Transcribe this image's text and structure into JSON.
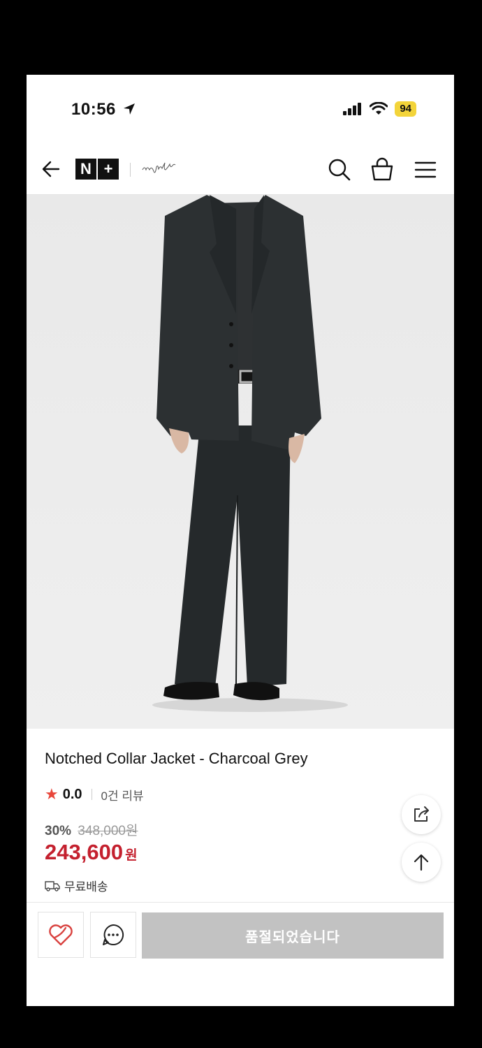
{
  "status_bar": {
    "time": "10:56",
    "battery": "94"
  },
  "header": {
    "logo_left": "N",
    "logo_right": "+",
    "brand_signature": "nyouth"
  },
  "product": {
    "title": "Notched Collar Jacket - Charcoal Grey",
    "rating": "0.0",
    "review_count": "0건 리뷰",
    "discount_percent": "30%",
    "original_price": "348,000원",
    "price": "243,600",
    "currency": "원",
    "shipping": "무료배송"
  },
  "actions": {
    "buy_label": "품절되었습니다"
  },
  "colors": {
    "accent_price": "#c4202e",
    "star": "#e8463a",
    "battery": "#f3d43a",
    "soldout_bg": "#c2c2c2"
  },
  "icons": [
    "back-arrow-icon",
    "search-icon",
    "shopping-bag-icon",
    "hamburger-menu-icon",
    "share-icon",
    "arrow-up-icon",
    "heart-icon",
    "chat-icon",
    "truck-icon",
    "star-icon",
    "location-arrow-icon",
    "signal-icon",
    "wifi-icon"
  ]
}
